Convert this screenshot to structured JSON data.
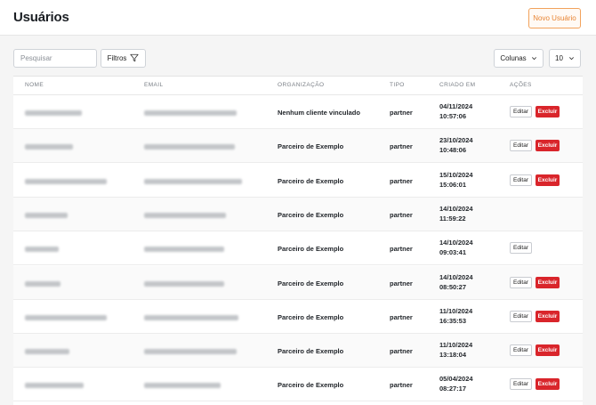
{
  "header": {
    "title": "Usuários",
    "new_user_label": "Novo Usuário"
  },
  "toolbar": {
    "search_placeholder": "Pesquisar",
    "filters_label": "Filtros",
    "columns_label": "Colunas",
    "page_size": "10"
  },
  "table": {
    "columns": [
      "NOME",
      "EMAIL",
      "ORGANIZAÇÃO",
      "TIPO",
      "CRIADO EM",
      "AÇÕES"
    ],
    "edit_label": "Editar",
    "delete_label": "Excluir",
    "rows": [
      {
        "org": "Nenhum cliente vinculado",
        "tipo": "partner",
        "date": "04/11/2024",
        "time": "10:57:06",
        "can_delete": true
      },
      {
        "org": "Parceiro de Exemplo",
        "tipo": "partner",
        "date": "23/10/2024",
        "time": "10:48:06",
        "can_delete": true
      },
      {
        "org": "Parceiro de Exemplo",
        "tipo": "partner",
        "date": "15/10/2024",
        "time": "15:06:01",
        "can_delete": true
      },
      {
        "org": "Parceiro de Exemplo",
        "tipo": "partner",
        "date": "14/10/2024",
        "time": "11:59:22",
        "can_delete": false,
        "hide_actions": true
      },
      {
        "org": "Parceiro de Exemplo",
        "tipo": "partner",
        "date": "14/10/2024",
        "time": "09:03:41",
        "can_delete": false
      },
      {
        "org": "Parceiro de Exemplo",
        "tipo": "partner",
        "date": "14/10/2024",
        "time": "08:50:27",
        "can_delete": true
      },
      {
        "org": "Parceiro de Exemplo",
        "tipo": "partner",
        "date": "11/10/2024",
        "time": "16:35:53",
        "can_delete": true
      },
      {
        "org": "Parceiro de Exemplo",
        "tipo": "partner",
        "date": "11/10/2024",
        "time": "13:18:04",
        "can_delete": true
      },
      {
        "org": "Parceiro de Exemplo",
        "tipo": "partner",
        "date": "05/04/2024",
        "time": "08:27:17",
        "can_delete": true
      }
    ]
  },
  "colors": {
    "accent": "#e88432",
    "danger": "#d9252b"
  }
}
